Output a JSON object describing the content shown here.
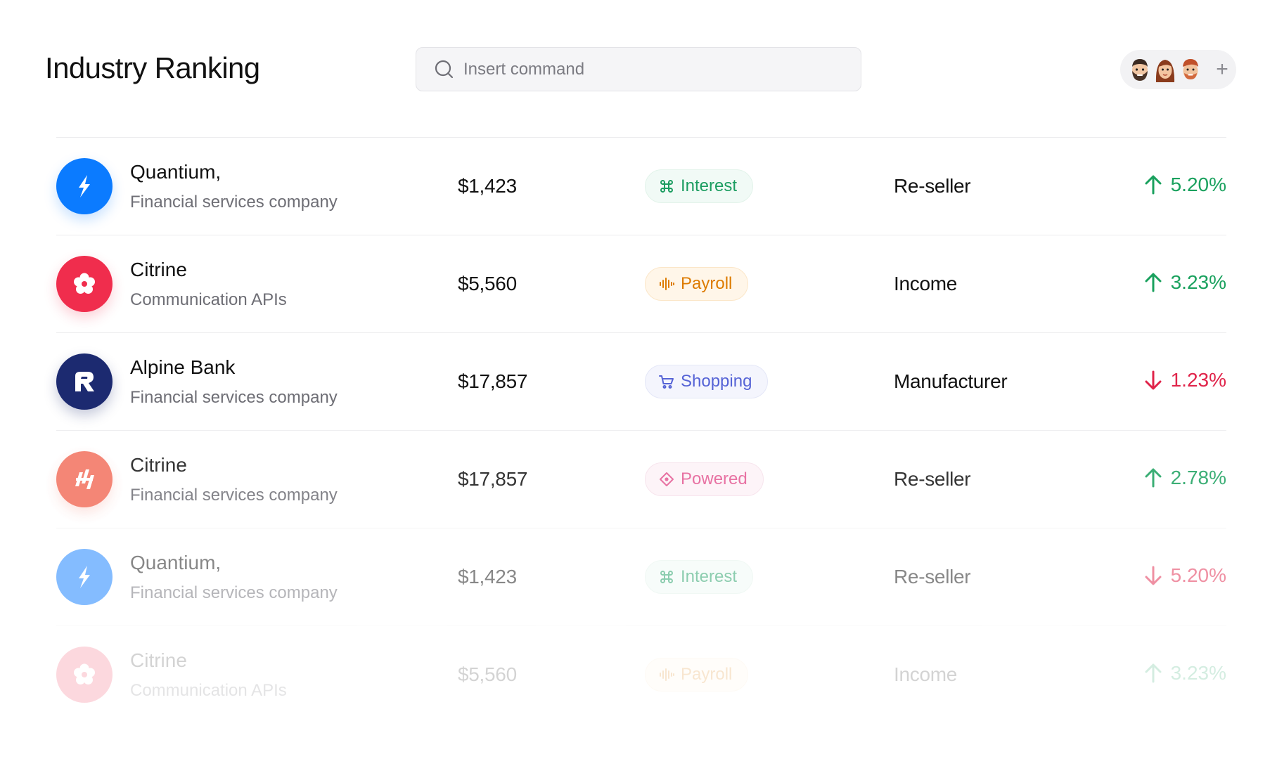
{
  "header": {
    "title": "Industry Ranking",
    "search_placeholder": "Insert command",
    "add_label": "+"
  },
  "rows": [
    {
      "name": "Quantium,",
      "description": "Financial services company",
      "amount": "$1,423",
      "tag": "Interest",
      "tag_icon": "command-icon",
      "category": "Re-seller",
      "change": "5.20%",
      "trend": "up",
      "logo_icon": "flame-icon",
      "logo_color": "#0b7bff"
    },
    {
      "name": "Citrine",
      "description": "Communication APIs",
      "amount": "$5,560",
      "tag": "Payroll",
      "tag_icon": "waveform-icon",
      "category": "Income",
      "change": "3.23%",
      "trend": "up",
      "logo_icon": "flower-icon",
      "logo_color": "#f02d4d"
    },
    {
      "name": "Alpine Bank",
      "description": "Financial services company",
      "amount": "$17,857",
      "tag": "Shopping",
      "tag_icon": "cart-icon",
      "category": "Manufacturer",
      "change": "1.23%",
      "trend": "down",
      "logo_icon": "r-letter-icon",
      "logo_color": "#1c2a70"
    },
    {
      "name": "Citrine",
      "description": "Financial services company",
      "amount": "$17,857",
      "tag": "Powered",
      "tag_icon": "diamond-icon",
      "category": "Re-seller",
      "change": "2.78%",
      "trend": "up",
      "logo_icon": "slash-bars-icon",
      "logo_color": "#f3725f"
    },
    {
      "name": "Quantium,",
      "description": "Financial services company",
      "amount": "$1,423",
      "tag": "Interest",
      "tag_icon": "command-icon",
      "category": "Re-seller",
      "change": "5.20%",
      "trend": "down",
      "logo_icon": "flame-icon",
      "logo_color": "#0b7bff"
    },
    {
      "name": "Citrine",
      "description": "Communication APIs",
      "amount": "$5,560",
      "tag": "Payroll",
      "tag_icon": "waveform-icon",
      "category": "Income",
      "change": "3.23%",
      "trend": "up",
      "logo_icon": "flower-icon",
      "logo_color": "#f02d4d"
    }
  ],
  "colors": {
    "up": "#1aa15e",
    "down": "#e0244a"
  }
}
